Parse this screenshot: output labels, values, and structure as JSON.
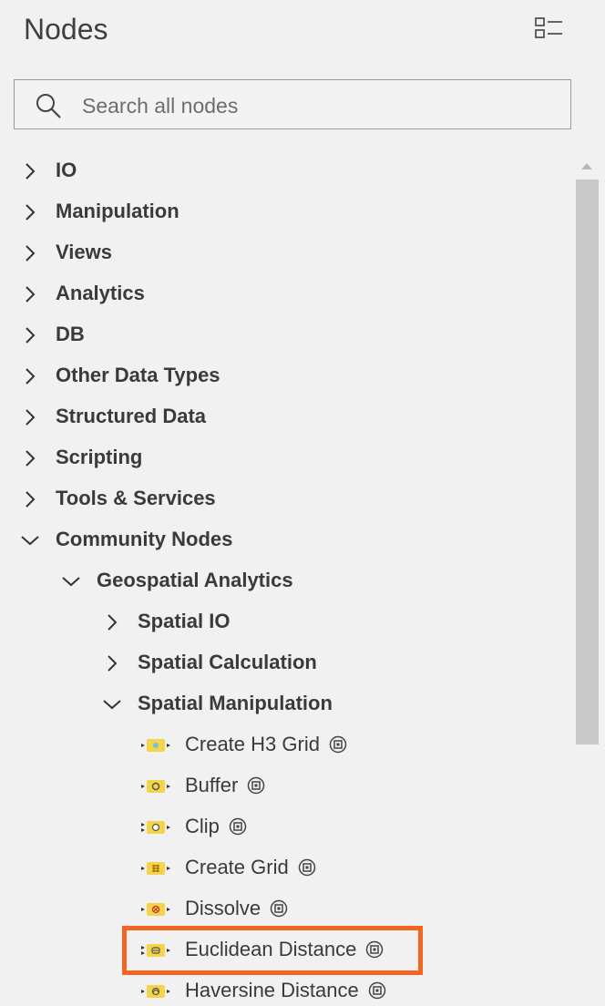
{
  "header": {
    "title": "Nodes",
    "display_toggle_icon": "list-view-icon"
  },
  "search": {
    "placeholder": "Search all nodes",
    "value": ""
  },
  "tree": {
    "categories": [
      {
        "label": "IO",
        "expanded": false
      },
      {
        "label": "Manipulation",
        "expanded": false
      },
      {
        "label": "Views",
        "expanded": false
      },
      {
        "label": "Analytics",
        "expanded": false
      },
      {
        "label": "DB",
        "expanded": false
      },
      {
        "label": "Other Data Types",
        "expanded": false
      },
      {
        "label": "Structured Data",
        "expanded": false
      },
      {
        "label": "Scripting",
        "expanded": false
      },
      {
        "label": "Tools & Services",
        "expanded": false
      },
      {
        "label": "Community Nodes",
        "expanded": true
      }
    ],
    "community": {
      "geospatial": {
        "label": "Geospatial Analytics",
        "expanded": true
      },
      "spatial_io": {
        "label": "Spatial IO",
        "expanded": false
      },
      "spatial_calc": {
        "label": "Spatial Calculation",
        "expanded": false
      },
      "spatial_manip": {
        "label": "Spatial Manipulation",
        "expanded": true
      },
      "nodes": [
        {
          "label": "Create H3 Grid",
          "icon": "h3-grid-node-icon"
        },
        {
          "label": "Buffer",
          "icon": "buffer-node-icon"
        },
        {
          "label": "Clip",
          "icon": "clip-node-icon"
        },
        {
          "label": "Create Grid",
          "icon": "create-grid-node-icon"
        },
        {
          "label": "Dissolve",
          "icon": "dissolve-node-icon"
        },
        {
          "label": "Euclidean Distance",
          "icon": "euclidean-distance-node-icon"
        },
        {
          "label": "Haversine Distance",
          "icon": "haversine-distance-node-icon"
        }
      ]
    }
  },
  "colors": {
    "node_yellow": "#f6d44a",
    "highlight": "#f26522",
    "scrollbar": "#c9c9c9"
  }
}
